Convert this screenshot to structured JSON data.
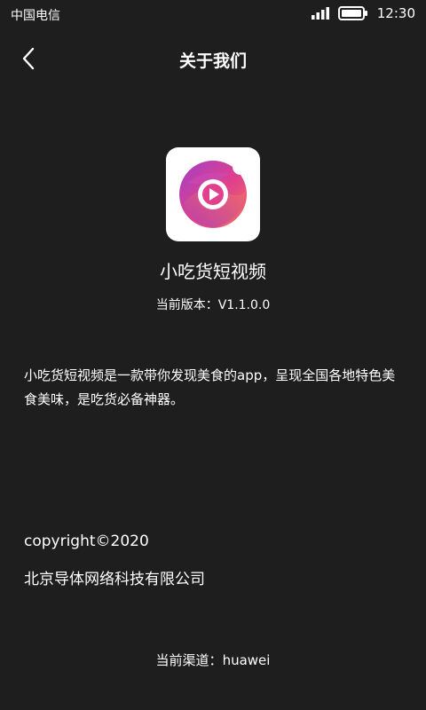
{
  "status_bar": {
    "carrier": "中国电信",
    "time": "12:30",
    "icons": [
      "signal-icon",
      "battery-icon"
    ]
  },
  "nav": {
    "title": "关于我们",
    "back_icon": "chevron-left-icon"
  },
  "app": {
    "icon": "app-logo-play-icon",
    "name": "小吃货短视频",
    "version_label": "当前版本：",
    "version": "V1.1.0.0",
    "description": "小吃货短视频是一款带你发现美食的app，呈现全国各地特色美食美味，是吃货必备神器。"
  },
  "footer": {
    "copyright": "copyright©2020",
    "company": "北京导体网络科技有限公司",
    "channel_label": "当前渠道：",
    "channel": "huawei"
  },
  "colors": {
    "background": "#1e1e1e",
    "text": "#ffffff",
    "logo_pink": "#e0408c",
    "logo_purple": "#9b3fc4",
    "logo_orange": "#f2735a"
  }
}
